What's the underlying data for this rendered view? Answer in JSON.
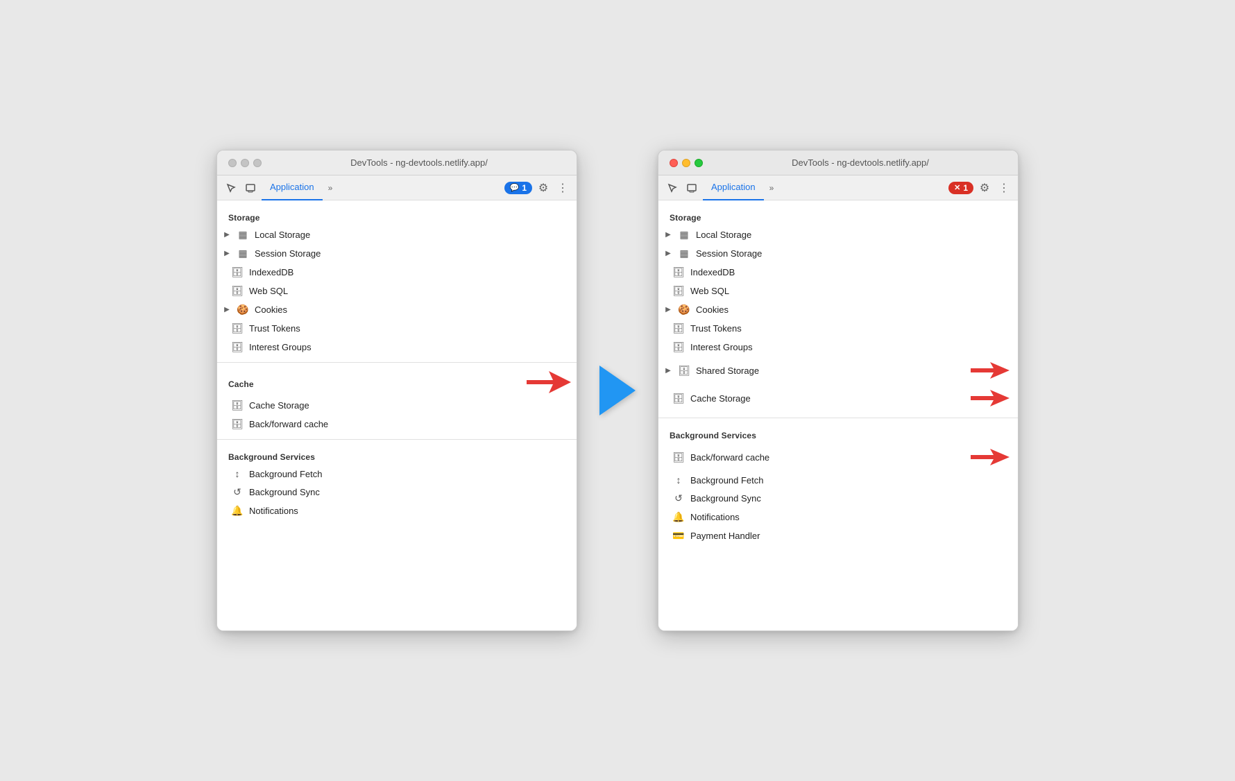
{
  "app": {
    "title": "DevTools - ng-devtools.netlify.app/",
    "tab_label": "Application",
    "chevron": "»",
    "badge_left": {
      "icon": "💬",
      "count": "1"
    },
    "badge_right": {
      "icon": "✕",
      "count": "1"
    },
    "gear": "⚙",
    "more": "⋮"
  },
  "left_panel": {
    "storage_header": "Storage",
    "items_storage": [
      {
        "id": "local-storage",
        "expandable": true,
        "icon": "▦",
        "label": "Local Storage"
      },
      {
        "id": "session-storage",
        "expandable": true,
        "icon": "▦",
        "label": "Session Storage"
      },
      {
        "id": "indexed-db",
        "expandable": false,
        "icon": "🗄",
        "label": "IndexedDB"
      },
      {
        "id": "web-sql",
        "expandable": false,
        "icon": "🗄",
        "label": "Web SQL"
      },
      {
        "id": "cookies",
        "expandable": true,
        "icon": "🍪",
        "label": "Cookies"
      },
      {
        "id": "trust-tokens",
        "expandable": false,
        "icon": "🗄",
        "label": "Trust Tokens"
      },
      {
        "id": "interest-groups",
        "expandable": false,
        "icon": "🗄",
        "label": "Interest Groups"
      }
    ],
    "cache_header": "Cache",
    "items_cache": [
      {
        "id": "cache-storage",
        "expandable": false,
        "icon": "🗄",
        "label": "Cache Storage"
      },
      {
        "id": "back-forward-cache",
        "expandable": false,
        "icon": "🗄",
        "label": "Back/forward cache"
      }
    ],
    "bg_services_header": "Background Services",
    "items_bg": [
      {
        "id": "bg-fetch",
        "expandable": false,
        "icon": "↕",
        "label": "Background Fetch"
      },
      {
        "id": "bg-sync",
        "expandable": false,
        "icon": "↺",
        "label": "Background Sync"
      },
      {
        "id": "notifications",
        "expandable": false,
        "icon": "🔔",
        "label": "Notifications"
      }
    ]
  },
  "right_panel": {
    "storage_header": "Storage",
    "items_storage": [
      {
        "id": "local-storage",
        "expandable": true,
        "icon": "▦",
        "label": "Local Storage"
      },
      {
        "id": "session-storage",
        "expandable": true,
        "icon": "▦",
        "label": "Session Storage"
      },
      {
        "id": "indexed-db",
        "expandable": false,
        "icon": "🗄",
        "label": "IndexedDB"
      },
      {
        "id": "web-sql",
        "expandable": false,
        "icon": "🗄",
        "label": "Web SQL"
      },
      {
        "id": "cookies",
        "expandable": true,
        "icon": "🍪",
        "label": "Cookies"
      },
      {
        "id": "trust-tokens",
        "expandable": false,
        "icon": "🗄",
        "label": "Trust Tokens"
      },
      {
        "id": "interest-groups",
        "expandable": false,
        "icon": "🗄",
        "label": "Interest Groups"
      },
      {
        "id": "shared-storage",
        "expandable": true,
        "icon": "🗄",
        "label": "Shared Storage"
      },
      {
        "id": "cache-storage",
        "expandable": false,
        "icon": "🗄",
        "label": "Cache Storage"
      }
    ],
    "bg_services_header": "Background Services",
    "items_bg": [
      {
        "id": "back-forward-cache",
        "expandable": false,
        "icon": "🗄",
        "label": "Back/forward cache"
      },
      {
        "id": "bg-fetch",
        "expandable": false,
        "icon": "↕",
        "label": "Background Fetch"
      },
      {
        "id": "bg-sync",
        "expandable": false,
        "icon": "↺",
        "label": "Background Sync"
      },
      {
        "id": "notifications",
        "expandable": false,
        "icon": "🔔",
        "label": "Notifications"
      },
      {
        "id": "payment-handler",
        "expandable": false,
        "icon": "💳",
        "label": "Payment Handler"
      }
    ]
  }
}
